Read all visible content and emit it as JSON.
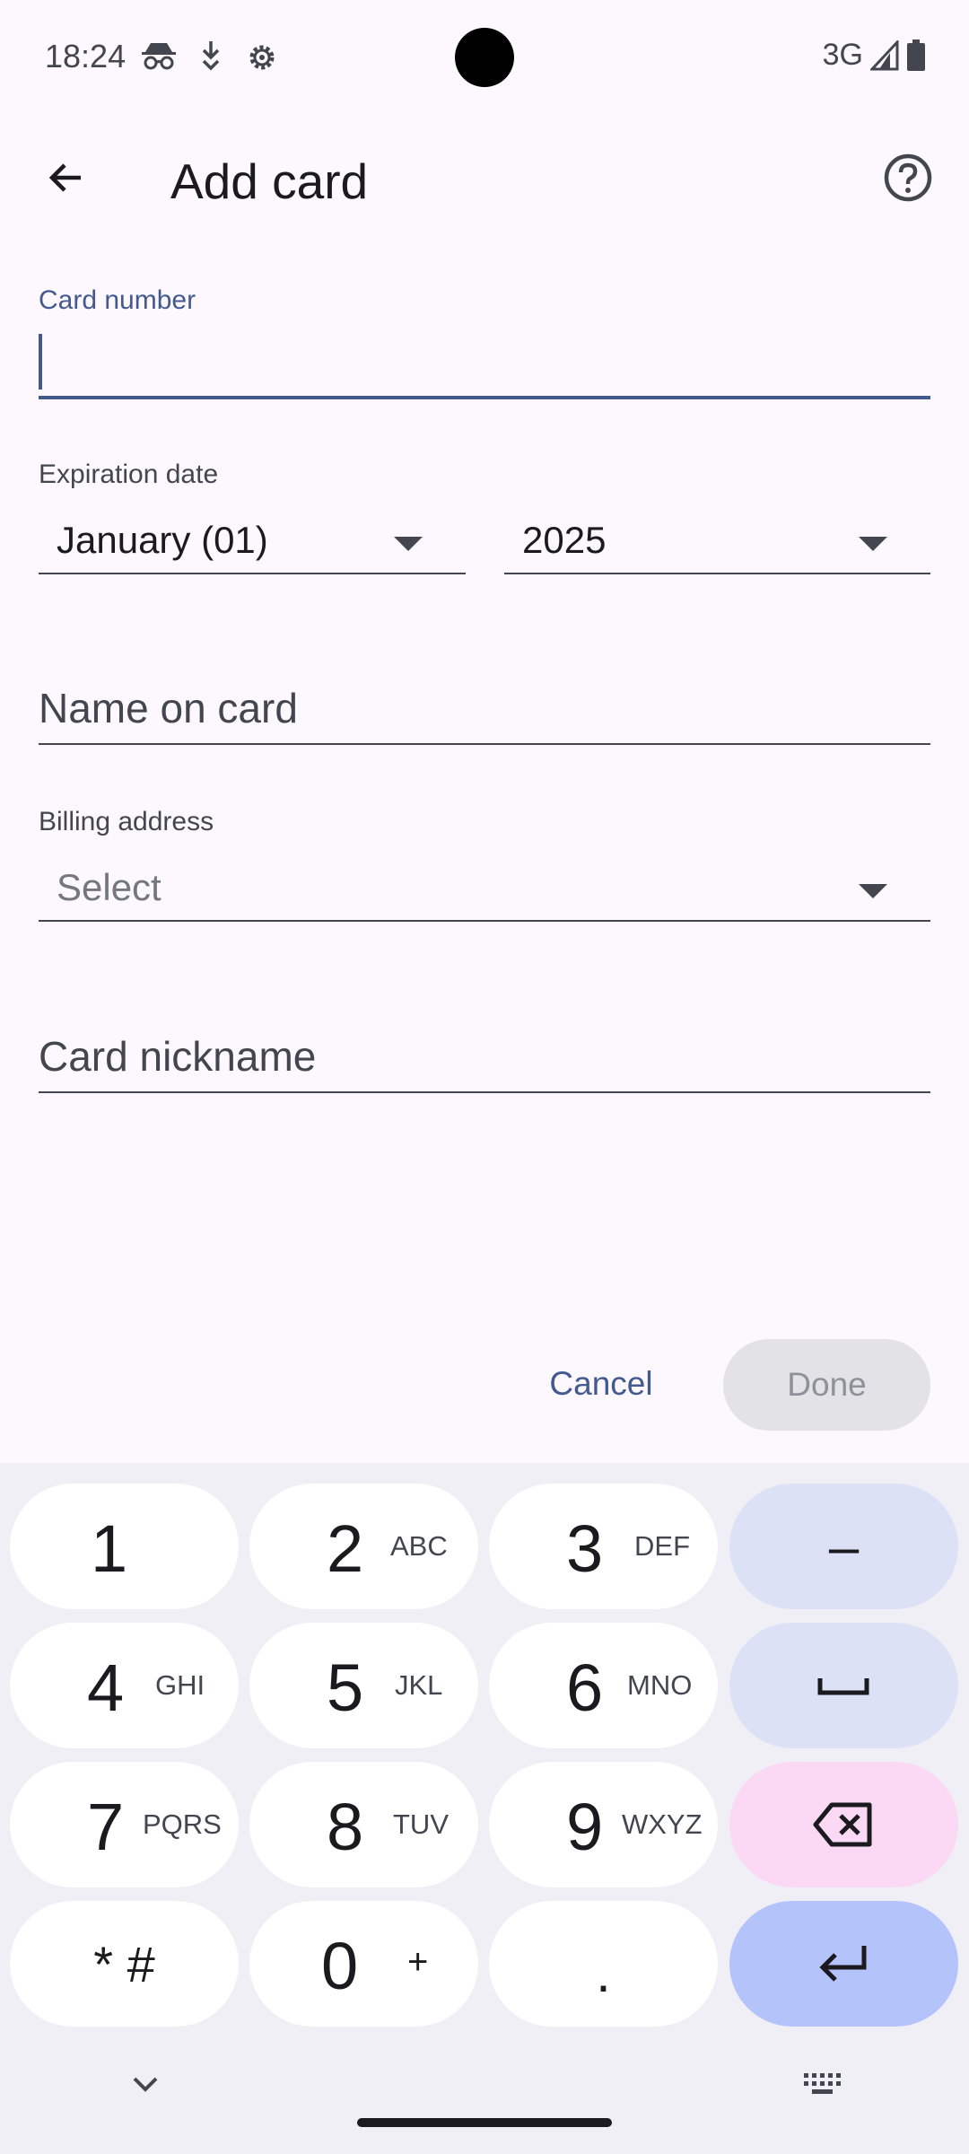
{
  "status_bar": {
    "time": "18:24",
    "network": "3G",
    "icons": [
      "incognito-icon",
      "download-icon",
      "settings-icon",
      "signal-icon",
      "battery-icon"
    ]
  },
  "app_bar": {
    "title": "Add card",
    "back_icon": "arrow-back-icon",
    "help_icon": "help-icon"
  },
  "form": {
    "card_number_label": "Card number",
    "card_number_value": "",
    "expiration_label": "Expiration date",
    "month_value": "January (01)",
    "year_value": "2025",
    "name_placeholder": "Name on card",
    "billing_label": "Billing address",
    "billing_value": "Select",
    "nickname_placeholder": "Card nickname"
  },
  "actions": {
    "cancel": "Cancel",
    "done": "Done"
  },
  "keyboard": {
    "keys": [
      {
        "num": "1",
        "letters": ""
      },
      {
        "num": "2",
        "letters": "ABC"
      },
      {
        "num": "3",
        "letters": "DEF"
      },
      {
        "num": "4",
        "letters": "GHI"
      },
      {
        "num": "5",
        "letters": "JKL"
      },
      {
        "num": "6",
        "letters": "MNO"
      },
      {
        "num": "7",
        "letters": "PQRS"
      },
      {
        "num": "8",
        "letters": "TUV"
      },
      {
        "num": "9",
        "letters": "WXYZ"
      },
      {
        "num": "0",
        "letters": "+"
      },
      {
        "num": "* #",
        "letters": ""
      },
      {
        "num": ".",
        "letters": ""
      }
    ],
    "dash": "–"
  },
  "colors": {
    "accent": "#44598f",
    "background": "#fcf8fd",
    "keyboard_bg": "#f1eff6",
    "fn_key": "#dde1f5",
    "delete_key": "#fbd8f4",
    "enter_key": "#b4c3fa"
  }
}
